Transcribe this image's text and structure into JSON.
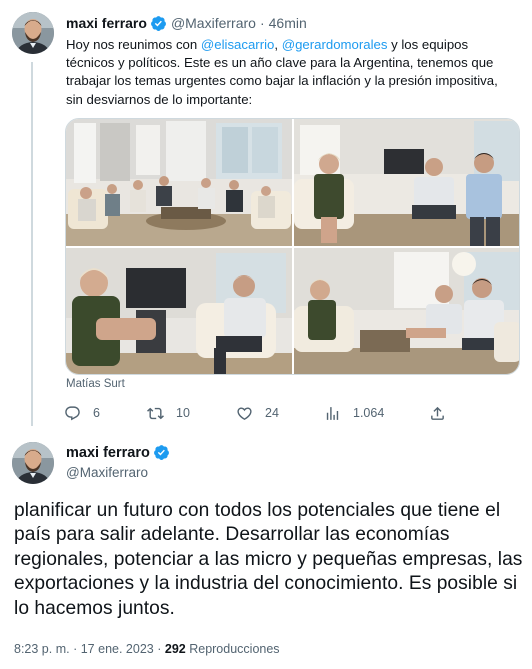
{
  "first_tweet": {
    "author_name": "maxi ferraro",
    "handle": "@Maxiferraro",
    "separator": "·",
    "time": "46min",
    "text_parts": [
      {
        "text": "Hoy nos reunimos con ",
        "type": "text"
      },
      {
        "text": "@elisacarrio",
        "type": "mention"
      },
      {
        "text": ", ",
        "type": "text"
      },
      {
        "text": "@gerardomorales",
        "type": "mention"
      },
      {
        "text": " y los equipos técnicos y políticos. Este es un año clave para la Argentina, tenemos que trabajar los temas urgentes como bajar la inflación y la presión impositiva, sin desviarnos de lo importante:",
        "type": "text"
      }
    ],
    "photo_credit": "Matías Surt",
    "actions": {
      "replies": "6",
      "retweets": "10",
      "likes": "24",
      "views": "1.064"
    }
  },
  "main_tweet": {
    "author_name": "maxi ferraro",
    "handle": "@Maxiferraro",
    "text": "planificar un futuro con todos los potenciales que tiene el país para salir adelante. Desarrollar las economías regionales, potenciar a las micro y pequeñas empresas, las exportaciones y la industria del conocimiento. Es posible si lo hacemos juntos.",
    "time": "8:23 p. m.",
    "date": "17 ene. 2023",
    "separator": "·",
    "views_count": "292",
    "views_label": "Reproducciones"
  },
  "icons": {
    "verified": "verified-badge-icon",
    "reply": "reply-icon",
    "retweet": "retweet-icon",
    "like": "heart-icon",
    "views": "views-chart-icon",
    "share": "share-icon"
  },
  "colors": {
    "accent": "#1d9bf0",
    "secondary_text": "#536471",
    "primary_text": "#0f1419",
    "thread_line": "#cfd9de"
  }
}
